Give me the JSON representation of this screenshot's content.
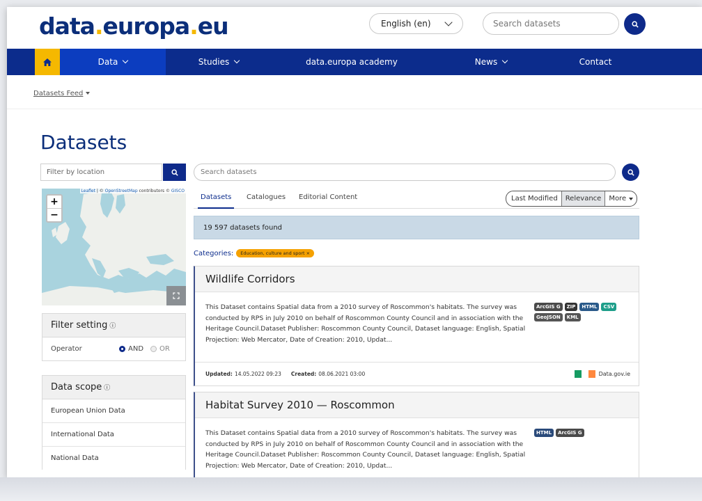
{
  "header": {
    "logo": {
      "part1": "data",
      "dot": ".",
      "part2": "europa",
      "dot2": ".",
      "part3": "eu"
    },
    "language": "English (en)",
    "search_placeholder": "Search datasets"
  },
  "nav": {
    "items": [
      {
        "label": "Data"
      },
      {
        "label": "Studies"
      },
      {
        "label": "data.europa academy"
      },
      {
        "label": "News"
      },
      {
        "label": "Contact"
      }
    ]
  },
  "breadcrumb": "Datasets Feed",
  "page_title": "Datasets",
  "location_filter": {
    "placeholder": "Filter by location"
  },
  "map": {
    "attribution_leaflet": "Leaflet",
    "attribution_mid": " | © ",
    "attribution_osm": "OpenStreetMap",
    "attribution_tail": " contributors © ",
    "attribution_gisco": "GISCO",
    "zoom_in": "+",
    "zoom_out": "−"
  },
  "filter_setting": {
    "title": "Filter setting",
    "info_mark": "ⓘ",
    "operator_label": "Operator",
    "and_label": "AND",
    "or_label": "OR",
    "selected": "AND"
  },
  "data_scope": {
    "title": "Data scope",
    "info_mark": "ⓘ",
    "items": [
      "European Union Data",
      "International Data",
      "National Data"
    ]
  },
  "main_search": {
    "placeholder": "Search datasets"
  },
  "tabs": [
    "Datasets",
    "Catalogues",
    "Editorial Content"
  ],
  "sort": {
    "options": [
      "Last Modified",
      "Relevance",
      "More"
    ],
    "active": "Relevance"
  },
  "results": {
    "text": "19 597 datasets found"
  },
  "categories": {
    "label": "Categories:",
    "tag": "Education, culture and sport",
    "remove": "×"
  },
  "datasets": [
    {
      "title": "Wildlife Corridors",
      "description": "This Dataset contains Spatial data from a 2010 survey of Roscommon's habitats. The survey was conducted by RPS in July 2010 on behalf of Roscommon County Council and in association with the Heritage Council.Dataset Publisher: Roscommon County Council, Dataset language: English, Spatial Projection: Web Mercator, Date of Creation: 2010, Updat...",
      "formats": [
        {
          "label": "ArcGIS G",
          "color": "#4a4a4a"
        },
        {
          "label": "ZIP",
          "color": "#333333"
        },
        {
          "label": "HTML",
          "color": "#2a5a8a"
        },
        {
          "label": "CSV",
          "color": "#1e9e8a"
        },
        {
          "label": "GeoJSON",
          "color": "#555555"
        },
        {
          "label": "KML",
          "color": "#555555"
        }
      ],
      "updated_label": "Updated:",
      "updated": "14.05.2022 09:23",
      "created_label": "Created:",
      "created": "08.06.2021 03:00",
      "publisher": "Data.gov.ie"
    },
    {
      "title": "Habitat Survey 2010 — Roscommon",
      "description": "This Dataset contains Spatial data from a 2010 survey of Roscommon's habitats. The survey was conducted by RPS in July 2010 on behalf of Roscommon County Council and in association with the Heritage Council.Dataset Publisher: Roscommon County Council, Dataset language: English, Spatial Projection: Web Mercator, Date of Creation: 2010, Updat...",
      "formats": [
        {
          "label": "HTML",
          "color": "#2a4a7a"
        },
        {
          "label": "ArcGIS G",
          "color": "#4a4a4a"
        }
      ]
    }
  ],
  "colors": {
    "brand_blue": "#0c2c8c",
    "accent_yellow": "#f5b800",
    "results_bg": "#c9d9e6"
  }
}
